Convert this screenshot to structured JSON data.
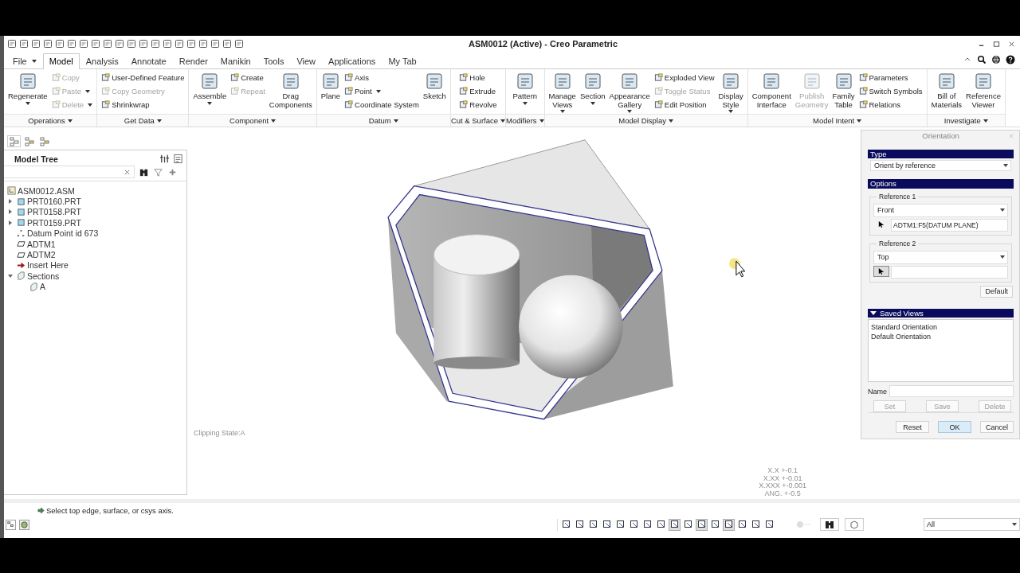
{
  "window": {
    "title": "ASM0012 (Active) - Creo Parametric"
  },
  "tabs": [
    {
      "label": "File",
      "selected": false,
      "menu": true
    },
    {
      "label": "Model",
      "selected": true
    },
    {
      "label": "Analysis",
      "selected": false
    },
    {
      "label": "Annotate",
      "selected": false
    },
    {
      "label": "Render",
      "selected": false
    },
    {
      "label": "Manikin",
      "selected": false
    },
    {
      "label": "Tools",
      "selected": false
    },
    {
      "label": "View",
      "selected": false
    },
    {
      "label": "Applications",
      "selected": false
    },
    {
      "label": "My Tab",
      "selected": false
    }
  ],
  "ribbon": [
    {
      "label": "Operations",
      "items": [
        {
          "kind": "large",
          "label": "Regenerate",
          "disabled": false,
          "menu": true
        },
        {
          "kind": "column",
          "items": [
            {
              "label": "Copy",
              "disabled": true
            },
            {
              "label": "Paste",
              "disabled": true,
              "menu": true
            },
            {
              "label": "Delete",
              "disabled": true,
              "menu": true
            }
          ]
        }
      ]
    },
    {
      "label": "Get Data",
      "items": [
        {
          "kind": "column",
          "items": [
            {
              "label": "User-Defined Feature",
              "disabled": false
            },
            {
              "label": "Copy Geometry",
              "disabled": true
            },
            {
              "label": "Shrinkwrap",
              "disabled": false
            }
          ]
        }
      ]
    },
    {
      "label": "Component",
      "items": [
        {
          "kind": "large",
          "label": "Assemble",
          "disabled": false,
          "menu": true
        },
        {
          "kind": "column",
          "items": [
            {
              "label": "Create",
              "disabled": false
            },
            {
              "label": "Repeat",
              "disabled": true
            }
          ]
        },
        {
          "kind": "large",
          "label": "Drag\nComponents",
          "disabled": false
        }
      ]
    },
    {
      "label": "Datum",
      "items": [
        {
          "kind": "large",
          "label": "Plane",
          "disabled": false
        },
        {
          "kind": "column",
          "items": [
            {
              "label": "Axis",
              "disabled": false
            },
            {
              "label": "Point",
              "disabled": false,
              "menu": true
            },
            {
              "label": "Coordinate System",
              "disabled": false
            }
          ]
        },
        {
          "kind": "large",
          "label": "Sketch",
          "disabled": false
        }
      ]
    },
    {
      "label": "Cut & Surface",
      "items": [
        {
          "kind": "column",
          "items": [
            {
              "label": "Hole",
              "disabled": false
            },
            {
              "label": "Extrude",
              "disabled": false
            },
            {
              "label": "Revolve",
              "disabled": false
            }
          ]
        }
      ]
    },
    {
      "label": "Modifiers",
      "items": [
        {
          "kind": "large",
          "label": "Pattern",
          "disabled": false,
          "menu": true
        }
      ]
    },
    {
      "label": "Model Display",
      "items": [
        {
          "kind": "large",
          "label": "Manage\nViews",
          "disabled": false,
          "menu": true
        },
        {
          "kind": "large",
          "label": "Section",
          "disabled": false,
          "menu": true
        },
        {
          "kind": "large",
          "label": "Appearance\nGallery",
          "disabled": false,
          "menu": true
        },
        {
          "kind": "column",
          "items": [
            {
              "label": "Exploded View",
              "disabled": false
            },
            {
              "label": "Toggle Status",
              "disabled": true
            },
            {
              "label": "Edit Position",
              "disabled": false
            }
          ]
        },
        {
          "kind": "large",
          "label": "Display\nStyle",
          "disabled": false,
          "menu": true
        }
      ]
    },
    {
      "label": "Model Intent",
      "items": [
        {
          "kind": "large",
          "label": "Component\nInterface",
          "disabled": false
        },
        {
          "kind": "large",
          "label": "Publish\nGeometry",
          "disabled": true
        },
        {
          "kind": "large",
          "label": "Family\nTable",
          "disabled": false
        },
        {
          "kind": "column",
          "items": [
            {
              "label": "Parameters",
              "disabled": false
            },
            {
              "label": "Switch Symbols",
              "disabled": false
            },
            {
              "label": "Relations",
              "disabled": false
            }
          ]
        }
      ]
    },
    {
      "label": "Investigate",
      "items": [
        {
          "kind": "large",
          "label": "Bill of\nMaterials",
          "disabled": false
        },
        {
          "kind": "large",
          "label": "Reference\nViewer",
          "disabled": false
        }
      ]
    }
  ],
  "model_tree": {
    "panel_tabs": [
      {
        "selected": true
      },
      {
        "selected": false
      },
      {
        "selected": false
      }
    ],
    "title": "Model Tree",
    "items": [
      {
        "label": "ASM0012.ASM",
        "kind": "assembly",
        "children": [
          {
            "label": "PRT0160.PRT",
            "kind": "part",
            "expanded": false
          },
          {
            "label": "PRT0158.PRT",
            "kind": "part",
            "expanded": false
          },
          {
            "label": "PRT0159.PRT",
            "kind": "part",
            "expanded": false
          },
          {
            "label": "Datum Point id 673",
            "kind": "point"
          },
          {
            "label": "ADTM1",
            "kind": "plane"
          },
          {
            "label": "ADTM2",
            "kind": "plane"
          },
          {
            "label": "Insert Here",
            "kind": "insert"
          },
          {
            "label": "Sections",
            "kind": "section",
            "expanded": true,
            "children": [
              {
                "label": "A",
                "kind": "section"
              }
            ]
          }
        ]
      }
    ]
  },
  "viewport": {
    "clipping_state": "Clipping State:A",
    "tolerances": [
      "X.X +-0.1",
      "X.XX +-0.01",
      "X.XXX +-0.001",
      "ANG. +-0.5"
    ]
  },
  "dialog": {
    "title": "Orientation",
    "type_header": "Type",
    "type_value": "Orient by reference",
    "options_header": "Options",
    "references": [
      {
        "label": "Reference 1",
        "value": "Front",
        "reference": "ADTM1:F5(DATUM PLANE)",
        "selecting": false
      },
      {
        "label": "Reference 2",
        "value": "Top",
        "selecting": true
      }
    ],
    "default_button": "Default",
    "saved_views": {
      "header": "Saved Views",
      "expanded": true,
      "items": [
        "Standard Orientation",
        "Default Orientation"
      ]
    },
    "name_label": "Name",
    "view_buttons": [
      {
        "label": "Set",
        "disabled": true
      },
      {
        "label": "Save",
        "disabled": true
      },
      {
        "label": "Delete",
        "disabled": true
      }
    ],
    "buttons": [
      {
        "label": "Reset",
        "primary": false
      },
      {
        "label": "OK",
        "primary": true
      },
      {
        "label": "Cancel",
        "primary": false
      }
    ]
  },
  "status": {
    "message": "Select top edge, surface, or csys axis."
  },
  "view_tools": [
    {
      "pressed": false
    },
    {
      "pressed": false
    },
    {
      "pressed": false
    },
    {
      "pressed": false
    },
    {
      "pressed": false
    },
    {
      "pressed": false
    },
    {
      "pressed": false
    },
    {
      "pressed": false
    },
    {
      "pressed": true
    },
    {
      "pressed": false
    },
    {
      "pressed": true
    },
    {
      "pressed": false
    },
    {
      "pressed": true
    },
    {
      "pressed": false
    },
    {
      "pressed": false
    },
    {
      "pressed": false
    }
  ],
  "filter": {
    "value": "All"
  }
}
